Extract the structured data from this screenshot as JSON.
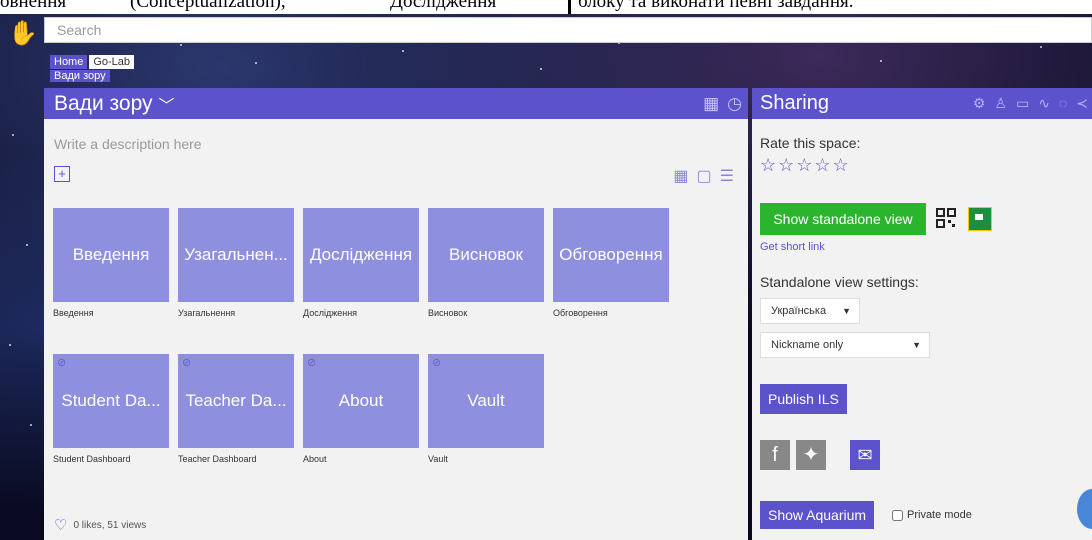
{
  "doc_strip": {
    "col1": "овнення",
    "col2": "(Conceptualization),",
    "col3": "Дослідження",
    "col4": "блоку та виконати певні завдання."
  },
  "search": {
    "placeholder": "Search"
  },
  "breadcrumb": {
    "home": "Home",
    "golab": "Go-Lab",
    "current": "Вади зору"
  },
  "space": {
    "title": "Вади зору",
    "description_placeholder": "Write a description here",
    "tiles": [
      {
        "label": "Введення",
        "caption": "Введення"
      },
      {
        "label": "Узагальнен...",
        "caption": "Узагальнення"
      },
      {
        "label": "Дослідження",
        "caption": "Дослідження"
      },
      {
        "label": "Висновок",
        "caption": "Висновок"
      },
      {
        "label": "Обговорення",
        "caption": "Обговорення"
      },
      {
        "label": "Student Da...",
        "caption": "Student Dashboard",
        "hidden": true
      },
      {
        "label": "Teacher Da...",
        "caption": "Teacher Dashboard",
        "hidden": true
      },
      {
        "label": "About",
        "caption": "About",
        "hidden": true
      },
      {
        "label": "Vault",
        "caption": "Vault",
        "hidden": true
      }
    ],
    "likes_views": "0 likes, 51 views"
  },
  "sharing": {
    "title": "Sharing",
    "rate_label": "Rate this space:",
    "stars": "☆☆☆☆☆",
    "rating": 0,
    "standalone_button": "Show standalone view",
    "short_link": "Get short link",
    "standalone_settings_label": "Standalone view settings:",
    "language_select": "Українська",
    "nickname_select": "Nickname only",
    "publish_button": "Publish ILS",
    "aquarium_button": "Show Aquarium",
    "private_mode": "Private mode"
  },
  "colors": {
    "accent": "#5b52cc",
    "tile": "#8f8fe0",
    "green": "#2bb52f",
    "social_gray": "#888888"
  },
  "icons": [
    "search-icon",
    "logo-icon",
    "grid-icon",
    "clock-icon",
    "settings-icon",
    "user-icon",
    "chat-icon",
    "chart-icon",
    "lightbulb-icon",
    "share-icon",
    "facebook-icon",
    "twitter-icon",
    "email-icon",
    "qr-icon",
    "classroom-icon",
    "heart-icon"
  ]
}
